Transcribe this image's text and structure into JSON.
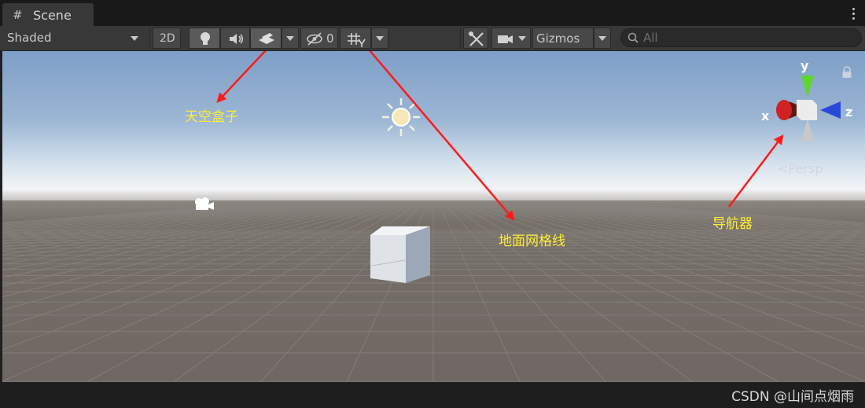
{
  "tab": {
    "title": "Scene",
    "icon": "grid-hash-icon"
  },
  "toolbar": {
    "draw_mode": "Shaded",
    "mode_2d": "2D",
    "hidden_count": "0",
    "gizmos_label": "Gizmos",
    "search_placeholder": "All"
  },
  "viewport": {
    "gizmo_axes": {
      "x": "x",
      "y": "y",
      "z": "z"
    },
    "projection": "Persp"
  },
  "annotations": {
    "skybox": "天空盒子",
    "ground_grid": "地面网格线",
    "navigator": "导航器",
    "arrow_color": "#ff1a1a",
    "label_color": "#ffee33"
  },
  "watermark": "CSDN @山间点烟雨",
  "colors": {
    "toolbar_bg": "#383838",
    "ground": "#6f6763",
    "sky_top": "#7e9fc8",
    "gizmo_y": "#5fd62a",
    "gizmo_x": "#d02222",
    "gizmo_z": "#2a48d8"
  }
}
